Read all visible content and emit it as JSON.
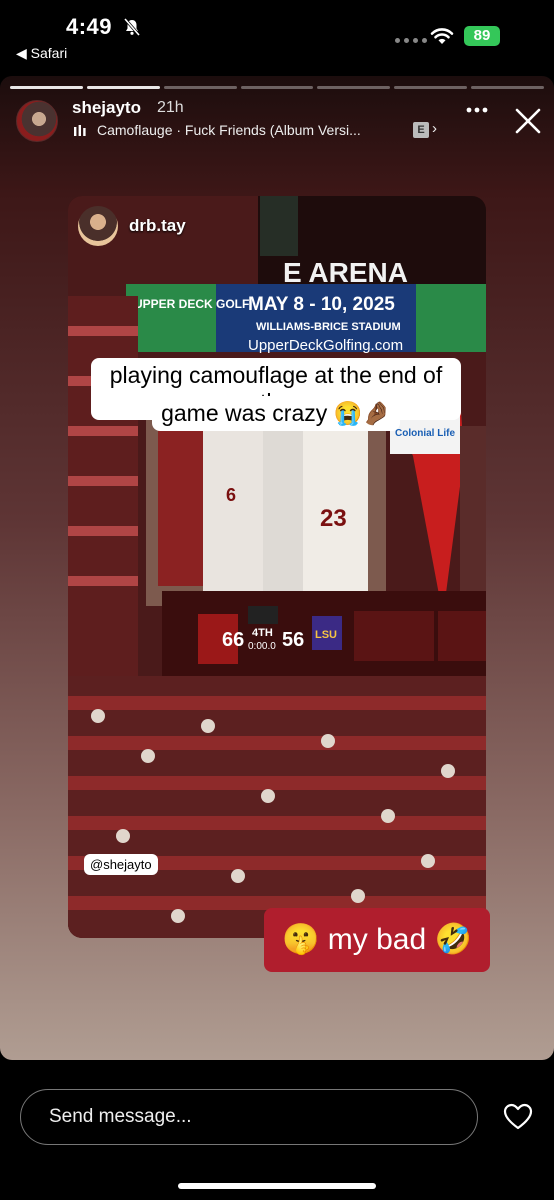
{
  "status_bar": {
    "time": "4:49",
    "back_label": "◀ Safari",
    "battery": "89"
  },
  "story": {
    "username": "shejayto",
    "time_ago": "21h",
    "music": "Camoflauge · Fuck Friends (Album Versi...",
    "explicit_badge": "E",
    "progress_segments": 7,
    "progress_done": 2
  },
  "repost": {
    "username": "drb.tay",
    "caption_line1": "playing camouflage at the end of the",
    "caption_line2": "game was crazy 😭🤌🏾",
    "scoreboard": {
      "ad_top": "MAY 8 - 10, 2025",
      "ad_sub": "WILLIAMS-BRICE STADIUM",
      "ad_url": "UpperDeckGolfing.com",
      "ad_brand": "UPPER DECK GOLF",
      "arena": "E ARENA",
      "colonial": "Colonial Life",
      "home_score": "66",
      "away_score": "56",
      "quarter": "4TH",
      "clock": "0:00.0",
      "away_team": "LSU",
      "jersey_a": "6",
      "jersey_b": "23"
    }
  },
  "mention_tag": "@shejayto",
  "mybad": "🤫 my bad 🤣",
  "bottom": {
    "message_placeholder": "Send message..."
  }
}
